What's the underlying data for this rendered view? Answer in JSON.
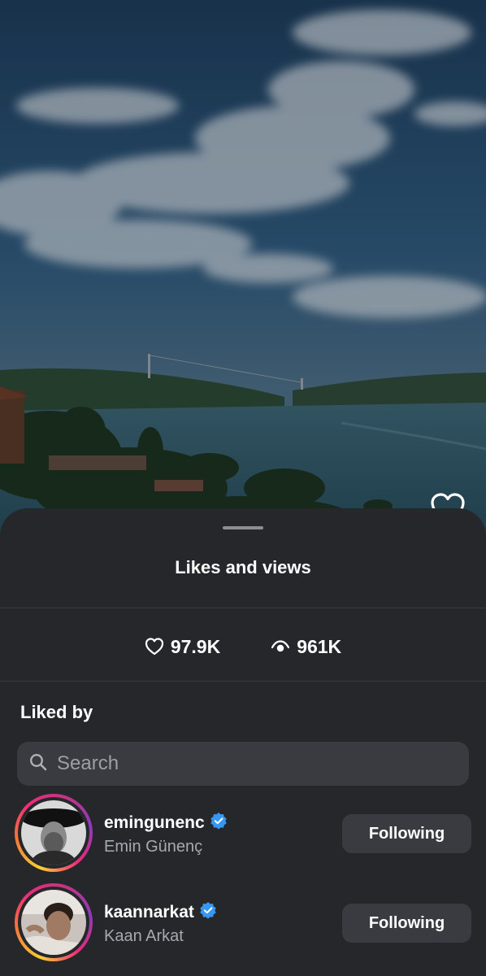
{
  "sheet": {
    "title": "Likes and views"
  },
  "stats": {
    "likes": "97.9K",
    "views": "961K"
  },
  "liked_by": {
    "title": "Liked by",
    "search_placeholder": "Search",
    "users": [
      {
        "username": "emingunenc",
        "full_name": "Emin Günenç",
        "verified": true,
        "button_label": "Following"
      },
      {
        "username": "kaannarkat",
        "full_name": "Kaan Arkat",
        "verified": true,
        "button_label": "Following"
      }
    ]
  },
  "colors": {
    "sheet_bg": "#26272b",
    "button_bg": "#3a3b40",
    "verified_blue": "#3897f0",
    "secondary_text": "#a8a8ae"
  },
  "icons": [
    "heart-icon",
    "eye-icon",
    "search-icon",
    "verified-badge-icon"
  ]
}
